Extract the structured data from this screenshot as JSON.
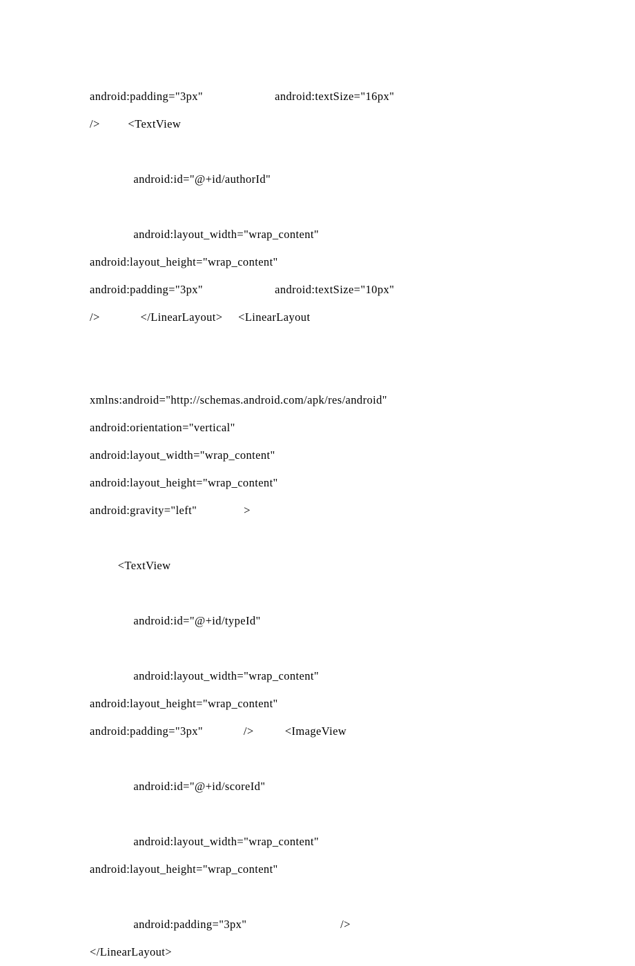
{
  "lines": [
    "android:padding=\"3px\"                       android:textSize=\"16px\"",
    "/>         <TextView",
    "",
    "              android:id=\"@+id/authorId\"",
    "",
    "              android:layout_width=\"wrap_content\"",
    "android:layout_height=\"wrap_content\"",
    "android:padding=\"3px\"                       android:textSize=\"10px\"",
    "/>             </LinearLayout>     <LinearLayout",
    "",
    "",
    "xmlns:android=\"http://schemas.android.com/apk/res/android\"",
    "android:orientation=\"vertical\"",
    "android:layout_width=\"wrap_content\"",
    "android:layout_height=\"wrap_content\"",
    "android:gravity=\"left\"               >",
    "",
    "         <TextView",
    "",
    "              android:id=\"@+id/typeId\"",
    "",
    "              android:layout_width=\"wrap_content\"",
    "android:layout_height=\"wrap_content\"",
    "android:padding=\"3px\"             />          <ImageView",
    "",
    "              android:id=\"@+id/scoreId\"",
    "",
    "              android:layout_width=\"wrap_content\"",
    "android:layout_height=\"wrap_content\"",
    "",
    "              android:padding=\"3px\"                              />",
    "</LinearLayout>"
  ]
}
